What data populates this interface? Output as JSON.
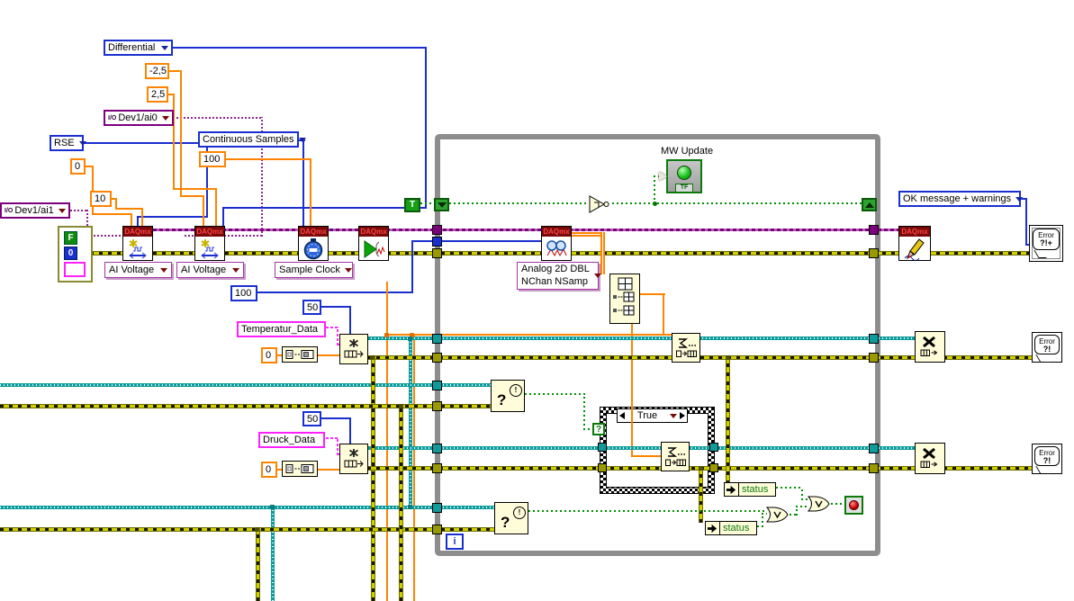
{
  "colors": {
    "wire_orange": "#FF8400",
    "wire_blue": "#1A2FCF",
    "wire_purple": "#7D007D",
    "wire_pink": "#FF22FF",
    "wire_teal": "#0F9B9B",
    "wire_error_olive": "#CFCF00",
    "wire_boolean_green": "#009100",
    "loop_border_gray": "#8D8D8D",
    "node_yellow": "#FFFCD9",
    "daqmx_banner_red": "#7A0A0A",
    "led_green": "#1DC21D",
    "stop_red": "#CC0000"
  },
  "io_constants": {
    "ai0": "Dev1/ai0",
    "ai1": "Dev1/ai1",
    "io_glyph": "I/O"
  },
  "enums": {
    "terminal_config_diff": "Differential",
    "terminal_config_rse": "RSE",
    "sample_mode": "Continuous Samples",
    "error_dialog_type": "OK message + warnings"
  },
  "numerics": {
    "min_diff": "-2,5",
    "max_diff": "2,5",
    "min_rse": "0",
    "max_rse": "10",
    "rate": "100",
    "samples_per_channel": "100",
    "queue_len_1": "50",
    "queue_len_2": "50",
    "init_val_1": "0",
    "init_val_2": "0"
  },
  "strings": {
    "queue_name_1": "Temperatur_Data",
    "queue_name_2": "Druck_Data"
  },
  "error_cluster": {
    "status": "F",
    "code": "0"
  },
  "daqmx": {
    "banner": "DAQmx",
    "channel_type": "AI Voltage",
    "timing_type": "Sample Clock",
    "read_mode_line1": "Analog 2D DBL",
    "read_mode_line2": "NChan NSamp"
  },
  "loop": {
    "iteration": "i",
    "true_const": "T"
  },
  "case": {
    "selector": "?",
    "label": "True"
  },
  "booleans": {
    "mw_update_label": "MW Update",
    "tf": "TF"
  },
  "nodes": {
    "qmark": "?",
    "bang": "!",
    "unbundle_field": "status"
  },
  "error_out": {
    "word": "Error",
    "qe": "?!",
    "qep": "?!+"
  }
}
